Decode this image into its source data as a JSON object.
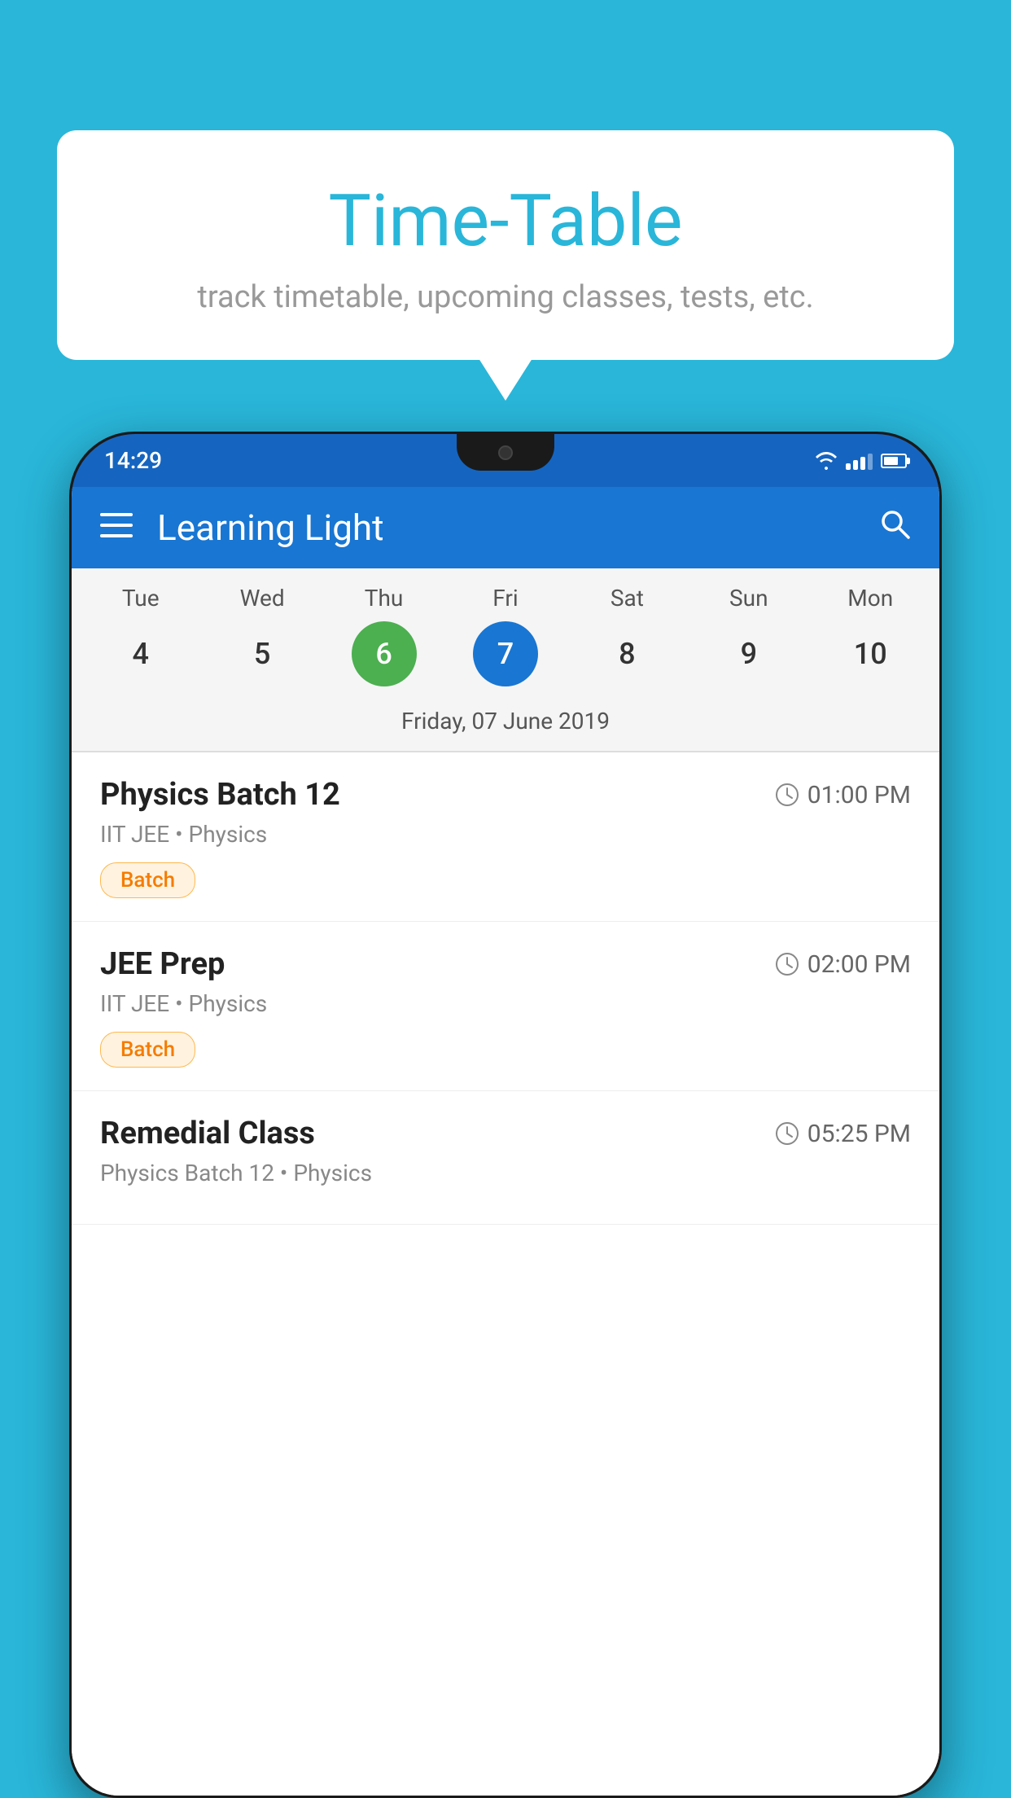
{
  "background_color": "#29B6D9",
  "speech_bubble": {
    "title": "Time-Table",
    "subtitle": "track timetable, upcoming classes, tests, etc."
  },
  "phone": {
    "status_bar": {
      "time": "14:29"
    },
    "app_bar": {
      "title": "Learning Light"
    },
    "calendar": {
      "days": [
        {
          "name": "Tue",
          "number": "4",
          "state": "normal"
        },
        {
          "name": "Wed",
          "number": "5",
          "state": "normal"
        },
        {
          "name": "Thu",
          "number": "6",
          "state": "today"
        },
        {
          "name": "Fri",
          "number": "7",
          "state": "selected"
        },
        {
          "name": "Sat",
          "number": "8",
          "state": "normal"
        },
        {
          "name": "Sun",
          "number": "9",
          "state": "normal"
        },
        {
          "name": "Mon",
          "number": "10",
          "state": "normal"
        }
      ],
      "selected_date_label": "Friday, 07 June 2019"
    },
    "schedule": [
      {
        "title": "Physics Batch 12",
        "time": "01:00 PM",
        "subtitle": "IIT JEE • Physics",
        "badge": "Batch"
      },
      {
        "title": "JEE Prep",
        "time": "02:00 PM",
        "subtitle": "IIT JEE • Physics",
        "badge": "Batch"
      },
      {
        "title": "Remedial Class",
        "time": "05:25 PM",
        "subtitle": "Physics Batch 12 • Physics",
        "badge": null
      }
    ]
  }
}
